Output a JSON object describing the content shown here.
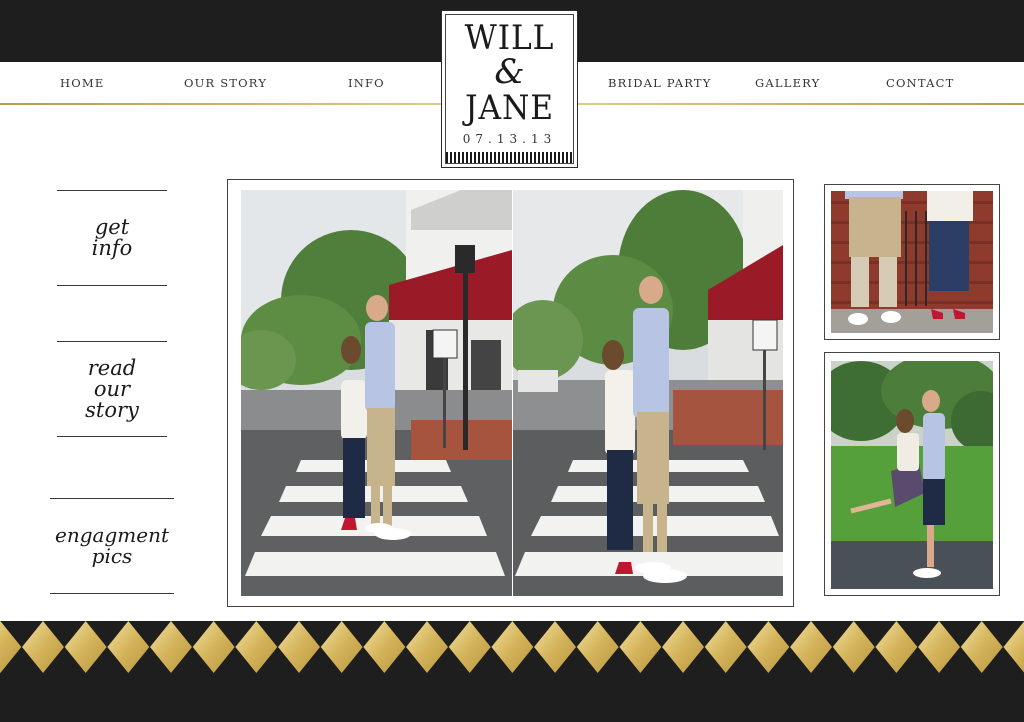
{
  "nav": {
    "left": [
      "HOME",
      "OUR STORY",
      "INFO"
    ],
    "right": [
      "BRIDAL PARTY",
      "GALLERY",
      "CONTACT"
    ]
  },
  "logo": {
    "line1": "WILL",
    "amp": "&",
    "line2": "JANE",
    "date": "07.13.13"
  },
  "sidebar": {
    "get_info": "get\ninfo",
    "read_story": "read\nour\nstory",
    "engagement": "engagment\npics"
  },
  "colors": {
    "dark": "#1e1e1e",
    "gold": "#d4b45a",
    "gold_light": "#f0dc8c"
  },
  "photos": {
    "main_left": "engagement-photo-crosswalk-1",
    "main_right": "engagement-photo-crosswalk-2",
    "thumb_top": "engagement-photo-shoes",
    "thumb_bottom": "engagement-photo-lift"
  }
}
